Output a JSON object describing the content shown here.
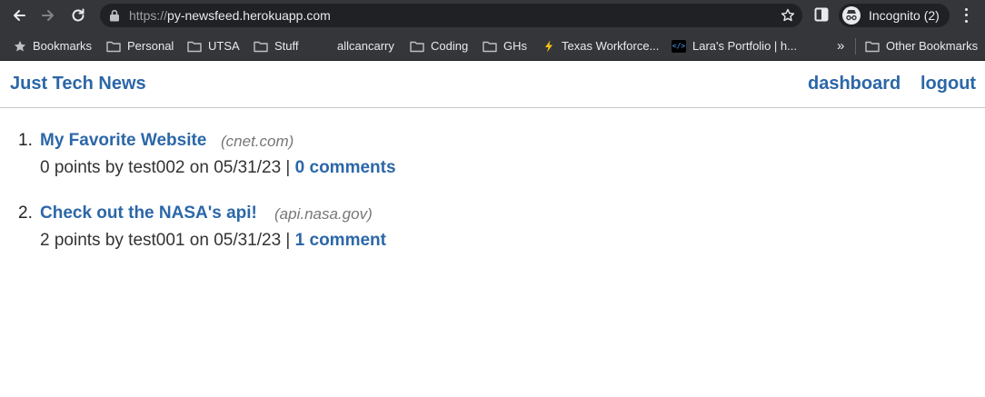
{
  "browser": {
    "url_scheme": "https://",
    "url_host": "py-newsfeed.herokuapp.com",
    "profile_label": "Incognito (2)",
    "bookmarks": [
      {
        "label": "Bookmarks",
        "icon": "star-icon"
      },
      {
        "label": "Personal",
        "icon": "folder-icon"
      },
      {
        "label": "UTSA",
        "icon": "folder-icon"
      },
      {
        "label": "Stuff",
        "icon": "folder-icon"
      },
      {
        "label": "allcancarry",
        "icon": "none"
      },
      {
        "label": "Coding",
        "icon": "folder-icon"
      },
      {
        "label": "GHs",
        "icon": "folder-icon"
      },
      {
        "label": "Texas Workforce...",
        "icon": "lightning-favicon"
      },
      {
        "label": "Lara's Portfolio | h...",
        "icon": "code-favicon"
      }
    ],
    "overflow_label": "»",
    "other_bookmarks": "Other Bookmarks"
  },
  "site": {
    "brand": "Just Tech News",
    "nav": {
      "dashboard": "dashboard",
      "logout": "logout"
    }
  },
  "posts": [
    {
      "number": "1.",
      "title": "My Favorite Website",
      "domain": "(cnet.com)",
      "meta": "0 points by test002 on 05/31/23 |",
      "comments": "0 comments"
    },
    {
      "number": "2.",
      "title": "Check out the NASA's api!",
      "domain": "(api.nasa.gov)",
      "meta": "2 points by test001 on 05/31/23 |",
      "comments": "1 comment"
    }
  ],
  "colors": {
    "link": "#2b67a8",
    "chrome": "#35363a",
    "omnibox": "#202124"
  }
}
